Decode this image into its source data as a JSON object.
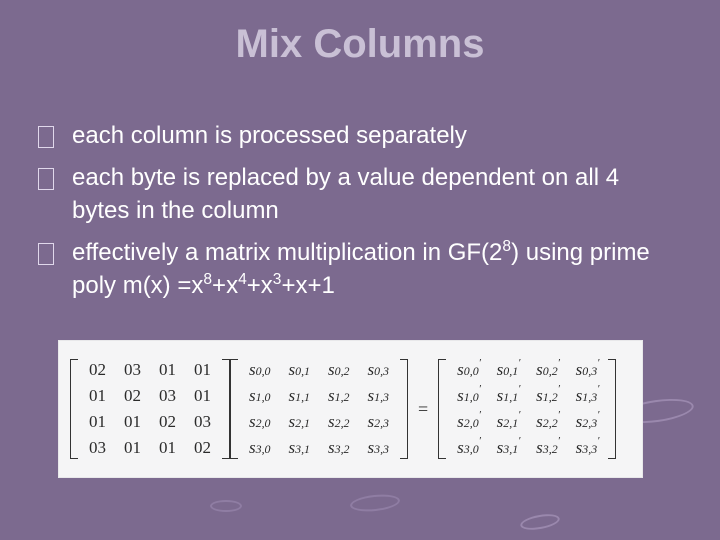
{
  "title": "Mix Columns",
  "bullets": [
    {
      "text": "each column is processed separately"
    },
    {
      "text": "each byte is replaced by a value dependent on all 4 bytes in the column"
    },
    {
      "html": "effectively a matrix multiplication in GF(2<sup>8</sup>) using prime poly m(x) =x<sup>8</sup>+x<sup>4</sup>+x<sup>3</sup>+x+1"
    }
  ],
  "equation": {
    "const_matrix": [
      [
        "02",
        "03",
        "01",
        "01"
      ],
      [
        "01",
        "02",
        "03",
        "01"
      ],
      [
        "01",
        "01",
        "02",
        "03"
      ],
      [
        "03",
        "01",
        "01",
        "02"
      ]
    ],
    "state_matrix_sym": "s",
    "state_rows": 4,
    "state_cols": 4,
    "equals": "=",
    "result_prime": true
  }
}
